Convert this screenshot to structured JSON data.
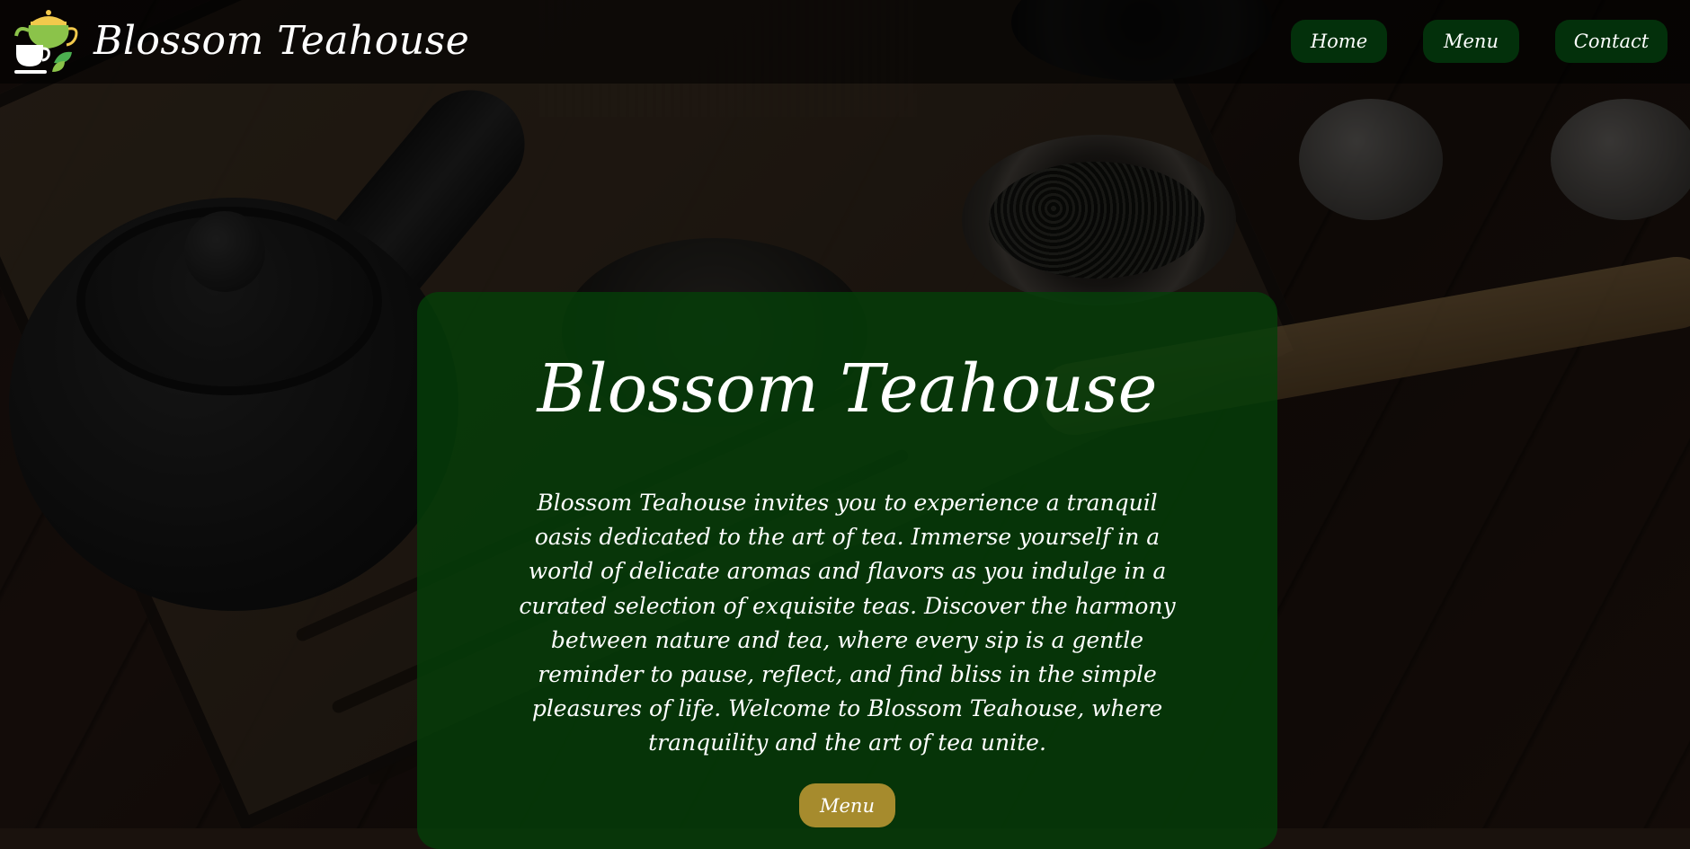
{
  "header": {
    "brand": "Blossom Teahouse",
    "logo_icon": "teapot-cup-leaf-icon",
    "nav": [
      {
        "label": "Home"
      },
      {
        "label": "Menu"
      },
      {
        "label": "Contact"
      }
    ]
  },
  "hero": {
    "title": "Blossom Teahouse",
    "text": "Blossom Teahouse invites you to experience a tranquil oasis dedicated to the art of tea. Immerse yourself in a world of delicate aromas and flavors as you indulge in a curated selection of exquisite teas. Discover the harmony between nature and tea, where every sip is a gentle reminder to pause, reflect, and find bliss in the simple pleasures of life. Welcome to Blossom Teahouse, where tranquility and the art of tea unite.",
    "cta_label": "Menu"
  },
  "colors": {
    "nav_button_bg": "#03300b",
    "card_bg": "#053e08",
    "cta_bg": "#a68b2d",
    "logo_green": "#8bc34a"
  }
}
